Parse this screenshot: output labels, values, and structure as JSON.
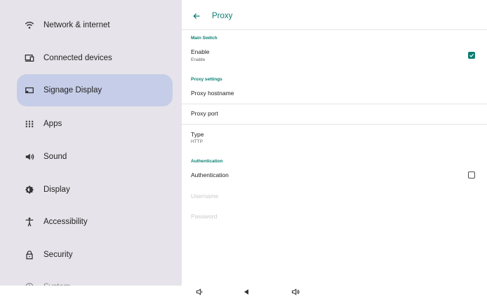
{
  "sidebar": {
    "items": [
      {
        "label": "Network & internet",
        "icon": "wifi-icon"
      },
      {
        "label": "Connected devices",
        "icon": "devices-icon"
      },
      {
        "label": "Signage Display",
        "icon": "signage-display-icon",
        "selected": true
      },
      {
        "label": "Apps",
        "icon": "apps-grid-icon"
      },
      {
        "label": "Sound",
        "icon": "speaker-icon"
      },
      {
        "label": "Display",
        "icon": "brightness-icon"
      },
      {
        "label": "Accessibility",
        "icon": "accessibility-icon"
      },
      {
        "label": "Security",
        "icon": "lock-icon"
      },
      {
        "label": "System",
        "icon": "info-icon"
      }
    ]
  },
  "header": {
    "title": "Proxy",
    "back_icon": "back-arrow-icon"
  },
  "main": {
    "main_switch": {
      "section": "Main Switch",
      "title": "Enable",
      "summary": "Enable",
      "checked": true
    },
    "proxy_settings": {
      "section": "Proxy settings",
      "hostname": "Proxy hostname",
      "port": "Proxy port",
      "type_title": "Type",
      "type_value": "HTTP"
    },
    "authentication": {
      "section": "Authentication",
      "title": "Authentication",
      "checked": false,
      "username": "Username",
      "password": "Password"
    }
  },
  "navbar": {
    "icons": [
      "volume-down-icon",
      "back-triangle-icon",
      "volume-up-icon"
    ]
  },
  "colors": {
    "accent": "#0b7f71",
    "sidebar_bg": "#e6e4ea",
    "selected_bg": "#c6cde8"
  }
}
